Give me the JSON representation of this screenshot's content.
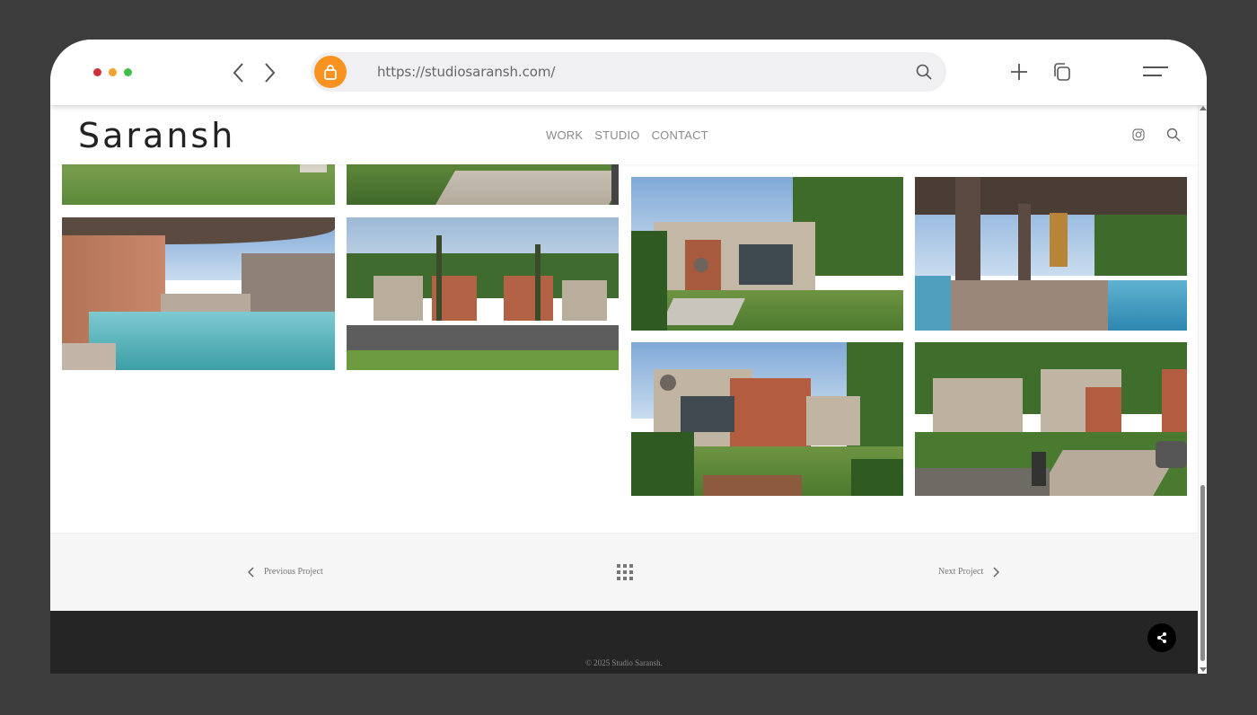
{
  "browser": {
    "url": "https://studiosaransh.com/",
    "colors": {
      "close": "#d0303a",
      "minimize": "#f0a22e",
      "maximize": "#3fbf4a",
      "lock": "#f7931e"
    }
  },
  "site": {
    "logo": "Saransh",
    "nav": [
      "WORK",
      "STUDIO",
      "CONTACT"
    ]
  },
  "gallery": {
    "images": [
      {
        "alt": "lawn-partial"
      },
      {
        "alt": "pathway-partial"
      },
      {
        "alt": "swimming-pool"
      },
      {
        "alt": "villa-street"
      },
      {
        "alt": "villa-front-lawn"
      },
      {
        "alt": "covered-veranda-pool"
      },
      {
        "alt": "villa-garden-view"
      },
      {
        "alt": "villa-driveway"
      }
    ]
  },
  "project_nav": {
    "previous": "Previous Project",
    "next": "Next Project"
  },
  "footer": {
    "copyright": "© 2025 Studio Saransh."
  }
}
